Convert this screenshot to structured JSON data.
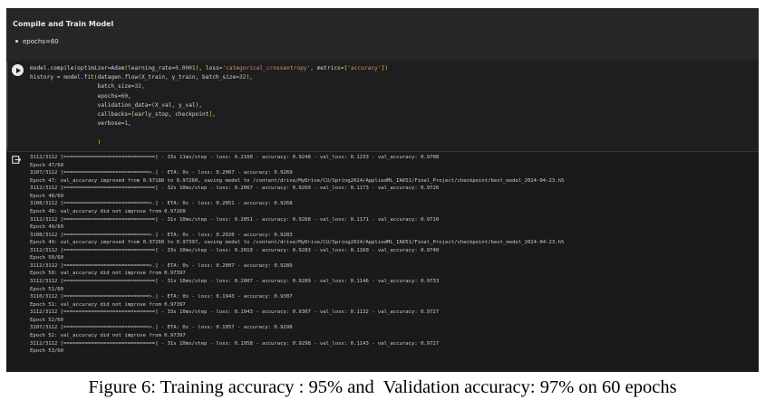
{
  "notebook": {
    "markdown_cell": {
      "title": "Compile and Train Model",
      "bullet": "epochs=60"
    },
    "code_cell": {
      "lines": [
        "model.compile(optimizer=Adam(learning_rate=0.0001), loss='categorical_crossentropy', metrics=['accuracy'])",
        "history = model.fit(datagen.flow(X_train, y_train, batch_size=32),",
        "                    batch_size=32,",
        "                    epochs=60,",
        "                    validation_data=(X_val, y_val),",
        "                    callbacks=[early_stop, checkpoint],",
        "                    verbose=1,",
        "",
        "                    )"
      ]
    },
    "output_cell": {
      "lines": [
        "3112/3112 [==============================] - 33s 11ms/step - loss: 0.2100 - accuracy: 0.9248 - val_loss: 0.1233 - val_accuracy: 0.9708",
        "Epoch 47/60",
        "3107/3112 [============================>.] - ETA: 0s - loss: 0.2067 - accuracy: 0.9269",
        "Epoch 47: val_accuracy improved from 0.97188 to 0.97260, saving model to /content/drive/MyDrive/CU/Spring2024/AppliedML_IA651/Final_Project/checkpoint/best_model_2024-04-23.h5",
        "3112/3112 [==============================] - 32s 10ms/step - loss: 0.2067 - accuracy: 0.9269 - val_loss: 0.1173 - val_accuracy: 0.9726",
        "Epoch 48/60",
        "3108/3112 [============================>.] - ETA: 0s - loss: 0.2051 - accuracy: 0.9268",
        "Epoch 48: val_accuracy did not improve from 0.97260",
        "3112/3112 [==============================] - 31s 10ms/step - loss: 0.2051 - accuracy: 0.9268 - val_loss: 0.1171 - val_accuracy: 0.9710",
        "Epoch 49/60",
        "3108/3112 [============================>.] - ETA: 0s - loss: 0.2020 - accuracy: 0.9283",
        "Epoch 49: val_accuracy improved from 0.97260 to 0.97397, saving model to /content/drive/MyDrive/CU/Spring2024/AppliedML_IA651/Final_Project/checkpoint/best_model_2024-04-23.h5",
        "3112/3112 [==============================] - 33s 10ms/step - loss: 0.2019 - accuracy: 0.9283 - val_loss: 0.1160 - val_accuracy: 0.9740",
        "Epoch 50/60",
        "3112/3112 [============================>.] - ETA: 0s - loss: 0.2007 - accuracy: 0.9289",
        "Epoch 50: val_accuracy did not improve from 0.97397",
        "3112/3112 [==============================] - 31s 10ms/step - loss: 0.2007 - accuracy: 0.9289 - val_loss: 0.1146 - val_accuracy: 0.9733",
        "Epoch 51/60",
        "3110/3112 [============================>.] - ETA: 0s - loss: 0.1943 - accuracy: 0.9307",
        "Epoch 51: val_accuracy did not improve from 0.97397",
        "3112/3112 [==============================] - 33s 10ms/step - loss: 0.1943 - accuracy: 0.9307 - val_loss: 0.1132 - val_accuracy: 0.9727",
        "Epoch 52/60",
        "3107/3112 [============================>.] - ETA: 0s - loss: 0.1957 - accuracy: 0.9298",
        "Epoch 52: val_accuracy did not improve from 0.97397",
        "3112/3112 [==============================] - 31s 10ms/step - loss: 0.1958 - accuracy: 0.9298 - val_loss: 0.1143 - val_accuracy: 0.9727",
        "Epoch 53/60"
      ]
    }
  },
  "caption": "Figure 6: Training accuracy : 95% and  Validation accuracy: 97% on 60 epochs",
  "icons": {
    "run": "play-circle-icon",
    "output": "output-exit-icon"
  },
  "colors": {
    "editor_bg": "#1e1e1e",
    "string": "#ce9178",
    "number": "#b5cea8",
    "bracket": "#ffd700"
  }
}
